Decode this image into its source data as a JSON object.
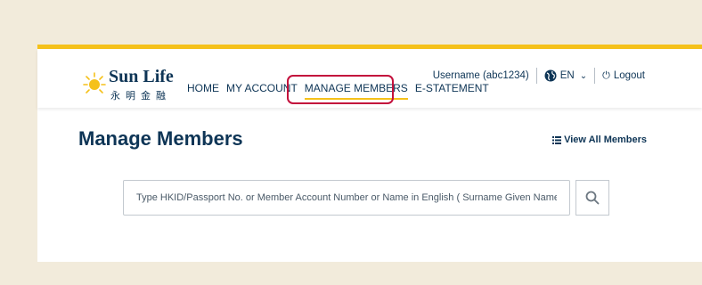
{
  "logo": {
    "title": "Sun Life",
    "chinese": "永明金融"
  },
  "nav": {
    "items": [
      {
        "label": "HOME",
        "active": false
      },
      {
        "label": "MY ACCOUNT",
        "active": false
      },
      {
        "label": "MANAGE MEMBERS",
        "active": true
      },
      {
        "label": "E-STATEMENT",
        "active": false
      }
    ]
  },
  "user_tools": {
    "username": "Username (abc1234)",
    "language": "EN",
    "logout": "Logout"
  },
  "page": {
    "title": "Manage Members",
    "view_all": "View All Members"
  },
  "search": {
    "placeholder": "Type HKID/Passport No. or Member Account Number or Name in English ( Surname Given Name)"
  },
  "colors": {
    "brand_navy": "#0e3556",
    "brand_yellow": "#f5c11a",
    "highlight": "#c3103c",
    "background": "#f2ebdb"
  }
}
